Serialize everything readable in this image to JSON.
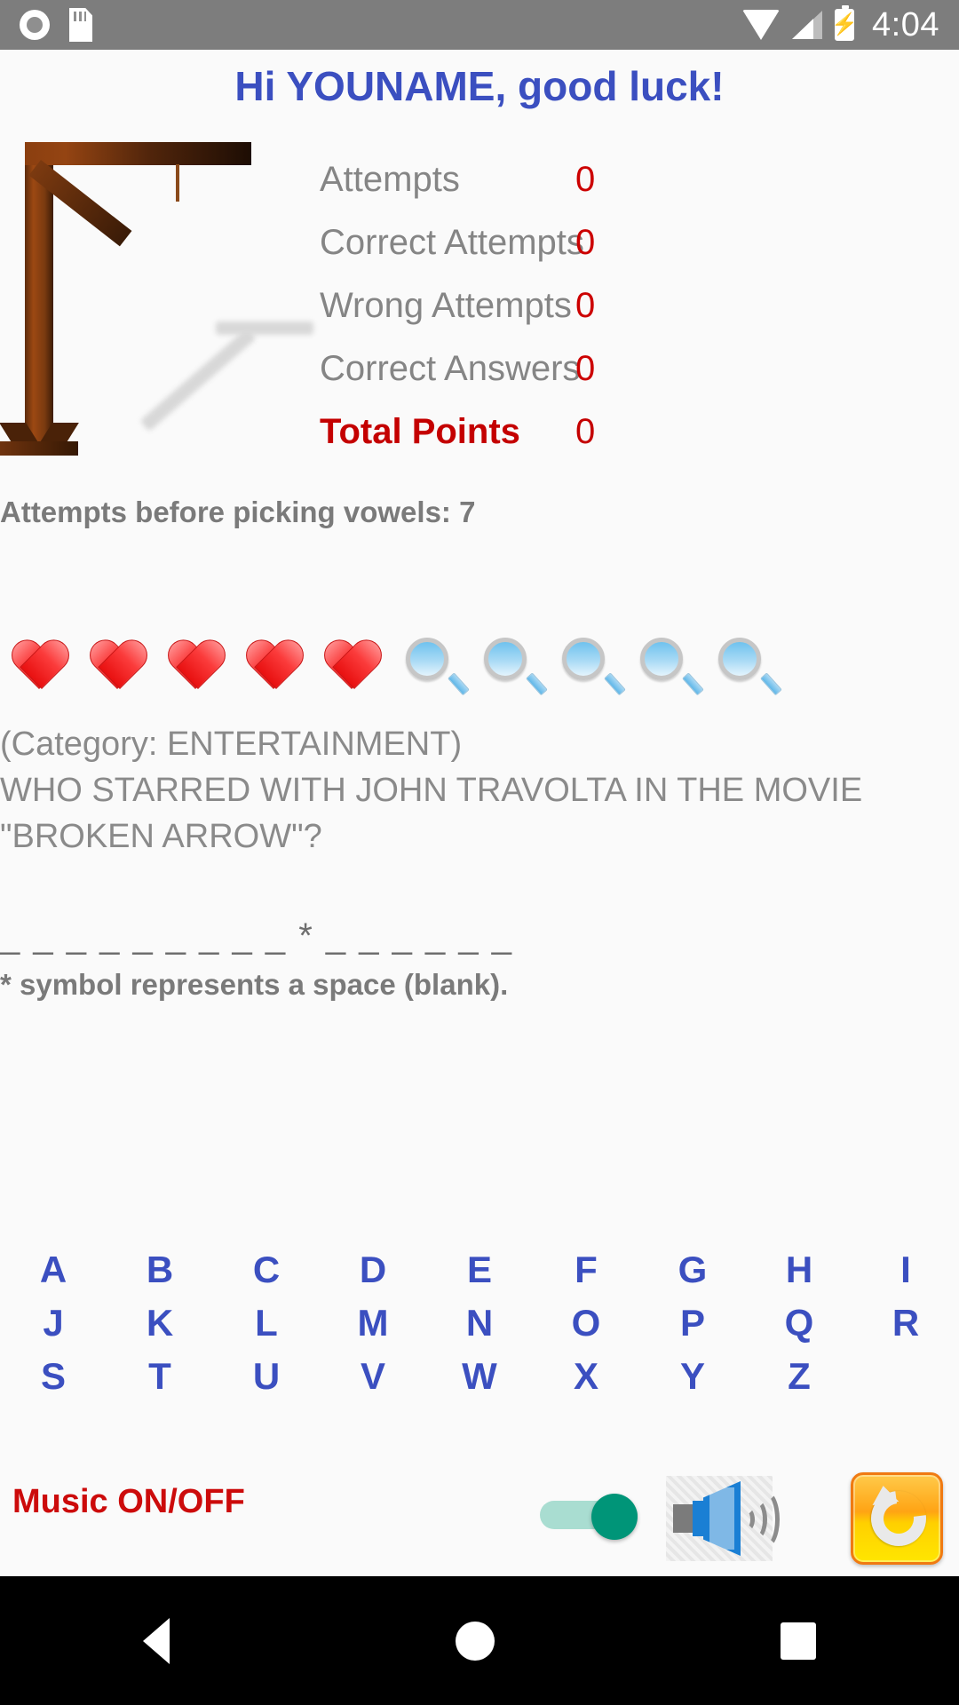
{
  "status_bar": {
    "icons_left": [
      "screen-record-icon",
      "sd-card-icon"
    ],
    "icons_right": [
      "wifi-icon",
      "cell-signal-icon",
      "battery-charging-icon"
    ],
    "time": "4:04"
  },
  "greeting": "Hi YOUNAME, good luck!",
  "gallows": {
    "alt": "hangman-gallows-graphic",
    "wood_color": "#7a3a10",
    "shadow_color": "#d8d8d8"
  },
  "stats": {
    "label_color": "#858585",
    "value_color": "#cc0000",
    "total_color": "#c40000",
    "rows": [
      {
        "label": "Attempts",
        "value": "0"
      },
      {
        "label": "Correct Attempts",
        "value": "0"
      },
      {
        "label": "Wrong Attempts",
        "value": "0"
      },
      {
        "label": "Correct Answers",
        "value": "0"
      },
      {
        "label": "Total Points",
        "value": "0"
      }
    ]
  },
  "vowel_note": "Attempts before picking vowels: 7",
  "lives": {
    "hearts": 5,
    "magnifiers": 5,
    "items": [
      "heart-icon",
      "heart-icon",
      "heart-icon",
      "heart-icon",
      "heart-icon",
      "magnifier-icon",
      "magnifier-icon",
      "magnifier-icon",
      "magnifier-icon",
      "magnifier-icon"
    ]
  },
  "question": {
    "category_line": "(Category: ENTERTAINMENT)",
    "text_line_1": "WHO STARRED WITH JOHN TRAVOLTA IN THE MOVIE",
    "text_line_2": "\"BROKEN ARROW\"?",
    "blanks": "_ _ _ _ _ _ _ _ _ * _ _ _ _ _ _",
    "star_note": "* symbol represents a space (blank)."
  },
  "keyboard": {
    "row1": [
      "A",
      "B",
      "C",
      "D",
      "E",
      "F",
      "G",
      "H",
      "I"
    ],
    "row2": [
      "J",
      "K",
      "L",
      "M",
      "N",
      "O",
      "P",
      "Q",
      "R"
    ],
    "row3": [
      "S",
      "T",
      "U",
      "V",
      "W",
      "X",
      "Y",
      "Z"
    ],
    "letter_color": "#3b4fc0"
  },
  "bottom_bar": {
    "music_label": "Music ON/OFF",
    "music_label_color": "#cc0b0b",
    "switch_on": true,
    "switch_accent": "#009578",
    "speaker_icon": "speaker-volume-icon",
    "restart_icon": "restart-refresh-icon"
  },
  "nav_bar": {
    "back": "back-triangle-icon",
    "home": "home-circle-icon",
    "recents": "recents-square-icon"
  }
}
